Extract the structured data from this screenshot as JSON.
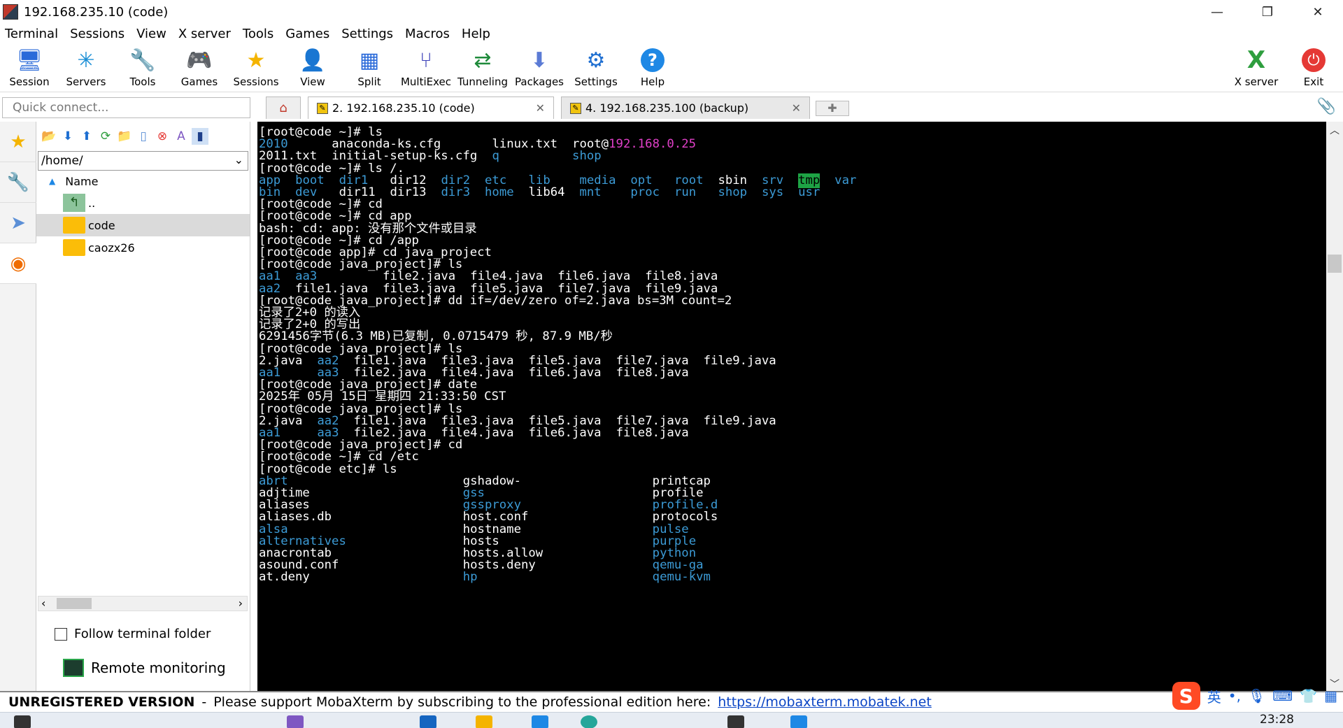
{
  "window": {
    "title": "192.168.235.10 (code)",
    "controls": [
      "—",
      "❐",
      "✕"
    ]
  },
  "menu": [
    "Terminal",
    "Sessions",
    "View",
    "X server",
    "Tools",
    "Games",
    "Settings",
    "Macros",
    "Help"
  ],
  "toolbar": {
    "buttons": [
      {
        "label": "Session",
        "icon": "session-icon",
        "glyph": "🖥"
      },
      {
        "label": "Servers",
        "icon": "servers-icon",
        "glyph": "✳"
      },
      {
        "label": "Tools",
        "icon": "tools-icon",
        "glyph": "🔧"
      },
      {
        "label": "Games",
        "icon": "games-icon",
        "glyph": "🎮"
      },
      {
        "label": "Sessions",
        "icon": "star-icon",
        "glyph": "★"
      },
      {
        "label": "View",
        "icon": "view-icon",
        "glyph": "👤"
      },
      {
        "label": "Split",
        "icon": "split-icon",
        "glyph": "▦"
      },
      {
        "label": "MultiExec",
        "icon": "multiexec-icon",
        "glyph": "⑂"
      },
      {
        "label": "Tunneling",
        "icon": "tunneling-icon",
        "glyph": "⇄"
      },
      {
        "label": "Packages",
        "icon": "packages-icon",
        "glyph": "⬇"
      },
      {
        "label": "Settings",
        "icon": "settings-icon",
        "glyph": "⚙"
      },
      {
        "label": "Help",
        "icon": "help-icon",
        "glyph": "?"
      }
    ],
    "right_buttons": [
      {
        "label": "X server",
        "icon": "xserver-icon",
        "glyph": "X"
      },
      {
        "label": "Exit",
        "icon": "power-icon",
        "glyph": "⏻"
      }
    ]
  },
  "quick_connect": {
    "placeholder": "Quick connect..."
  },
  "tabs": [
    {
      "label": "2. 192.168.235.10 (code)",
      "active": true
    },
    {
      "label": "4. 192.168.235.100 (backup)",
      "active": false
    }
  ],
  "sidebar": {
    "path": "/home/",
    "column_header": "Name",
    "items": [
      {
        "label": "..",
        "type": "up"
      },
      {
        "label": "code",
        "type": "folder",
        "selected": true
      },
      {
        "label": "caozx26",
        "type": "folder"
      }
    ],
    "follow_terminal_folder": "Follow terminal folder",
    "remote_monitoring": "Remote monitoring"
  },
  "terminal": {
    "lines": [
      [
        {
          "t": "[root@code ~]# ls",
          "c": "w",
          "col": 0
        }
      ],
      [
        {
          "t": "2010",
          "c": "b",
          "col": 0
        },
        {
          "t": "anaconda-ks.cfg",
          "c": "w",
          "col": 10
        },
        {
          "t": "linux.txt",
          "c": "w",
          "col": 32
        },
        {
          "t": "root@",
          "c": "w",
          "col": 43
        },
        {
          "t": "192.168.0.25",
          "c": "p",
          "col": 48
        }
      ],
      [
        {
          "t": "2011.txt",
          "c": "w",
          "col": 0
        },
        {
          "t": "initial-setup-ks.cfg",
          "c": "w",
          "col": 10
        },
        {
          "t": "q",
          "c": "b",
          "col": 32
        },
        {
          "t": "shop",
          "c": "b",
          "col": 43
        }
      ],
      [
        {
          "t": "[root@code ~]# ls /.",
          "c": "w",
          "col": 0
        }
      ],
      [
        {
          "t": "app",
          "c": "b",
          "col": 0
        },
        {
          "t": "boot",
          "c": "b",
          "col": 5
        },
        {
          "t": "dir1",
          "c": "b",
          "col": 11
        },
        {
          "t": "dir12",
          "c": "w",
          "col": 18
        },
        {
          "t": "dir2",
          "c": "b",
          "col": 25
        },
        {
          "t": "etc",
          "c": "b",
          "col": 31
        },
        {
          "t": "lib",
          "c": "b",
          "col": 37
        },
        {
          "t": "media",
          "c": "b",
          "col": 44
        },
        {
          "t": "opt",
          "c": "b",
          "col": 51
        },
        {
          "t": "root",
          "c": "b",
          "col": 57
        },
        {
          "t": "sbin",
          "c": "w",
          "col": 63
        },
        {
          "t": "srv",
          "c": "b",
          "col": 69
        },
        {
          "t": "tmp",
          "c": "tmp",
          "col": 74
        },
        {
          "t": "var",
          "c": "b",
          "col": 79
        }
      ],
      [
        {
          "t": "bin",
          "c": "b",
          "col": 0
        },
        {
          "t": "dev",
          "c": "b",
          "col": 5
        },
        {
          "t": "dir11",
          "c": "w",
          "col": 11
        },
        {
          "t": "dir13",
          "c": "w",
          "col": 18
        },
        {
          "t": "dir3",
          "c": "b",
          "col": 25
        },
        {
          "t": "home",
          "c": "b",
          "col": 31
        },
        {
          "t": "lib64",
          "c": "w",
          "col": 37
        },
        {
          "t": "mnt",
          "c": "b",
          "col": 44
        },
        {
          "t": "proc",
          "c": "b",
          "col": 51
        },
        {
          "t": "run",
          "c": "b",
          "col": 57
        },
        {
          "t": "shop",
          "c": "b",
          "col": 63
        },
        {
          "t": "sys",
          "c": "b",
          "col": 69
        },
        {
          "t": "usr",
          "c": "b",
          "col": 74
        }
      ],
      [
        {
          "t": "[root@code ~]# cd",
          "c": "w",
          "col": 0
        }
      ],
      [
        {
          "t": "[root@code ~]# cd app",
          "c": "w",
          "col": 0
        }
      ],
      [
        {
          "t": "bash: cd: app: 没有那个文件或目录",
          "c": "w",
          "col": 0
        }
      ],
      [
        {
          "t": "[root@code ~]# cd /app",
          "c": "w",
          "col": 0
        }
      ],
      [
        {
          "t": "[root@code app]# cd java_project",
          "c": "w",
          "col": 0
        }
      ],
      [
        {
          "t": "[root@code java_project]# ls",
          "c": "w",
          "col": 0
        }
      ],
      [
        {
          "t": "aa1",
          "c": "b",
          "col": 0
        },
        {
          "t": "aa3",
          "c": "b",
          "col": 5
        },
        {
          "t": "file2.java",
          "c": "w",
          "col": 17
        },
        {
          "t": "file4.java",
          "c": "w",
          "col": 29
        },
        {
          "t": "file6.java",
          "c": "w",
          "col": 41
        },
        {
          "t": "file8.java",
          "c": "w",
          "col": 53
        }
      ],
      [
        {
          "t": "aa2",
          "c": "b",
          "col": 0
        },
        {
          "t": "file1.java",
          "c": "w",
          "col": 5
        },
        {
          "t": "file3.java",
          "c": "w",
          "col": 17
        },
        {
          "t": "file5.java",
          "c": "w",
          "col": 29
        },
        {
          "t": "file7.java",
          "c": "w",
          "col": 41
        },
        {
          "t": "file9.java",
          "c": "w",
          "col": 53
        }
      ],
      [
        {
          "t": "[root@code java_project]# dd if=/dev/zero of=2.java bs=3M count=2",
          "c": "w",
          "col": 0
        }
      ],
      [
        {
          "t": "记录了2+0 的读入",
          "c": "w",
          "col": 0
        }
      ],
      [
        {
          "t": "记录了2+0 的写出",
          "c": "w",
          "col": 0
        }
      ],
      [
        {
          "t": "6291456字节(6.3 MB)已复制, 0.0715479 秒, 87.9 MB/秒",
          "c": "w",
          "col": 0
        }
      ],
      [
        {
          "t": "[root@code java_project]# ls",
          "c": "w",
          "col": 0
        }
      ],
      [
        {
          "t": "2.java",
          "c": "w",
          "col": 0
        },
        {
          "t": "aa2",
          "c": "b",
          "col": 8
        },
        {
          "t": "file1.java",
          "c": "w",
          "col": 13
        },
        {
          "t": "file3.java",
          "c": "w",
          "col": 25
        },
        {
          "t": "file5.java",
          "c": "w",
          "col": 37
        },
        {
          "t": "file7.java",
          "c": "w",
          "col": 49
        },
        {
          "t": "file9.java",
          "c": "w",
          "col": 61
        }
      ],
      [
        {
          "t": "aa1",
          "c": "b",
          "col": 0
        },
        {
          "t": "aa3",
          "c": "b",
          "col": 8
        },
        {
          "t": "file2.java",
          "c": "w",
          "col": 13
        },
        {
          "t": "file4.java",
          "c": "w",
          "col": 25
        },
        {
          "t": "file6.java",
          "c": "w",
          "col": 37
        },
        {
          "t": "file8.java",
          "c": "w",
          "col": 49
        }
      ],
      [
        {
          "t": "[root@code java_project]# date",
          "c": "w",
          "col": 0
        }
      ],
      [
        {
          "t": "2025年 05月 15日 星期四 21:33:50 CST",
          "c": "w",
          "col": 0
        }
      ],
      [
        {
          "t": "[root@code java_project]# ls",
          "c": "w",
          "col": 0
        }
      ],
      [
        {
          "t": "2.java",
          "c": "w",
          "col": 0
        },
        {
          "t": "aa2",
          "c": "b",
          "col": 8
        },
        {
          "t": "file1.java",
          "c": "w",
          "col": 13
        },
        {
          "t": "file3.java",
          "c": "w",
          "col": 25
        },
        {
          "t": "file5.java",
          "c": "w",
          "col": 37
        },
        {
          "t": "file7.java",
          "c": "w",
          "col": 49
        },
        {
          "t": "file9.java",
          "c": "w",
          "col": 61
        }
      ],
      [
        {
          "t": "aa1",
          "c": "b",
          "col": 0
        },
        {
          "t": "aa3",
          "c": "b",
          "col": 8
        },
        {
          "t": "file2.java",
          "c": "w",
          "col": 13
        },
        {
          "t": "file4.java",
          "c": "w",
          "col": 25
        },
        {
          "t": "file6.java",
          "c": "w",
          "col": 37
        },
        {
          "t": "file8.java",
          "c": "w",
          "col": 49
        }
      ],
      [
        {
          "t": "[root@code java_project]# cd",
          "c": "w",
          "col": 0
        }
      ],
      [
        {
          "t": "[root@code ~]# cd /etc",
          "c": "w",
          "col": 0
        }
      ],
      [
        {
          "t": "[root@code etc]# ls",
          "c": "w",
          "col": 0
        }
      ],
      [
        {
          "t": "abrt",
          "c": "b",
          "col": 0
        },
        {
          "t": "gshadow-",
          "c": "w",
          "col": 28
        },
        {
          "t": "printcap",
          "c": "w",
          "col": 54
        }
      ],
      [
        {
          "t": "adjtime",
          "c": "w",
          "col": 0
        },
        {
          "t": "gss",
          "c": "b",
          "col": 28
        },
        {
          "t": "profile",
          "c": "w",
          "col": 54
        }
      ],
      [
        {
          "t": "aliases",
          "c": "w",
          "col": 0
        },
        {
          "t": "gssproxy",
          "c": "b",
          "col": 28
        },
        {
          "t": "profile.d",
          "c": "b",
          "col": 54
        }
      ],
      [
        {
          "t": "aliases.db",
          "c": "w",
          "col": 0
        },
        {
          "t": "host.conf",
          "c": "w",
          "col": 28
        },
        {
          "t": "protocols",
          "c": "w",
          "col": 54
        }
      ],
      [
        {
          "t": "alsa",
          "c": "b",
          "col": 0
        },
        {
          "t": "hostname",
          "c": "w",
          "col": 28
        },
        {
          "t": "pulse",
          "c": "b",
          "col": 54
        }
      ],
      [
        {
          "t": "alternatives",
          "c": "b",
          "col": 0
        },
        {
          "t": "hosts",
          "c": "w",
          "col": 28
        },
        {
          "t": "purple",
          "c": "b",
          "col": 54
        }
      ],
      [
        {
          "t": "anacrontab",
          "c": "w",
          "col": 0
        },
        {
          "t": "hosts.allow",
          "c": "w",
          "col": 28
        },
        {
          "t": "python",
          "c": "b",
          "col": 54
        }
      ],
      [
        {
          "t": "asound.conf",
          "c": "w",
          "col": 0
        },
        {
          "t": "hosts.deny",
          "c": "w",
          "col": 28
        },
        {
          "t": "qemu-ga",
          "c": "b",
          "col": 54
        }
      ],
      [
        {
          "t": "at.deny",
          "c": "w",
          "col": 0
        },
        {
          "t": "hp",
          "c": "b",
          "col": 28
        },
        {
          "t": "qemu-kvm",
          "c": "b",
          "col": 54
        }
      ]
    ]
  },
  "status": {
    "unregistered": "UNREGISTERED VERSION",
    "dash": "-",
    "message": "Please support MobaXterm by subscribing to the professional edition here:",
    "link": "https://mobaxterm.mobatek.net"
  },
  "ime": {
    "logo": "S",
    "lang": "英",
    "punct": "•,",
    "mic": "🎙",
    "keyboard": "⌨",
    "shirt": "👕",
    "grid": "▦"
  },
  "taskbar": {
    "clock": "23:28"
  },
  "colors": {
    "terminal_bg": "#000000",
    "blue": "#3c9bd6",
    "pink": "#e040c8",
    "tmp_bg": "#1ea345",
    "link": "#0b45c5"
  }
}
